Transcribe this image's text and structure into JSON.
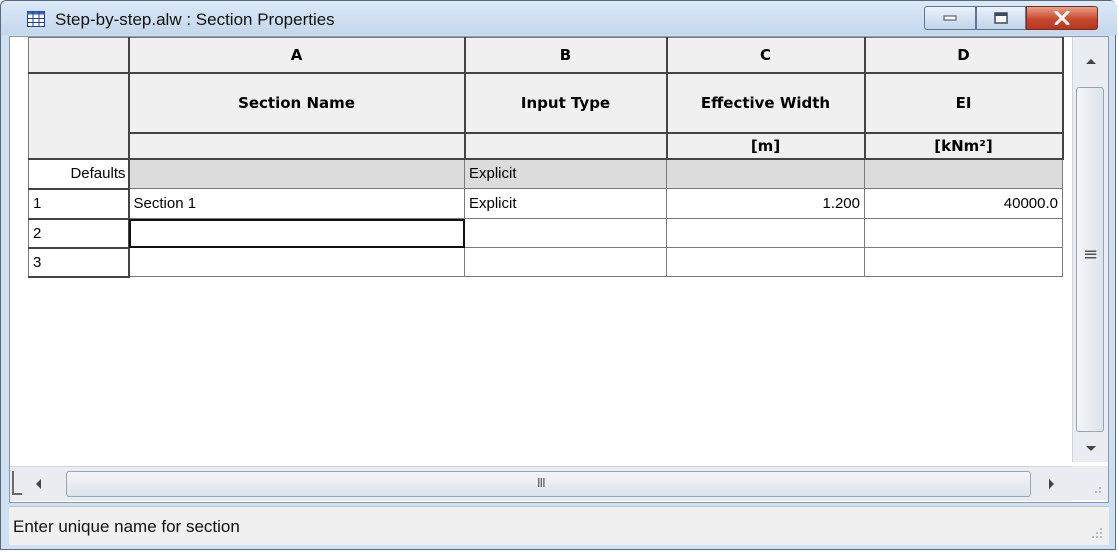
{
  "window": {
    "title": "Step-by-step.alw : Section Properties"
  },
  "grid": {
    "column_letters": [
      "A",
      "B",
      "C",
      "D"
    ],
    "column_titles": [
      "Section Name",
      "Input Type",
      "Effective Width",
      "EI"
    ],
    "column_units": [
      "",
      "",
      "[m]",
      "[kNm²]"
    ],
    "defaults_row": {
      "label": "Defaults",
      "cells": [
        "",
        "Explicit",
        "",
        ""
      ]
    },
    "rows": [
      {
        "label": "1",
        "cells": [
          "Section 1",
          "Explicit",
          "1.200",
          "40000.0"
        ]
      },
      {
        "label": "2",
        "cells": [
          "",
          "",
          "",
          ""
        ]
      },
      {
        "label": "3",
        "cells": [
          "",
          "",
          "",
          ""
        ]
      }
    ]
  },
  "scrollbar": {
    "h_thumb_glyph": "III",
    "v_thumb_glyph": "≡"
  },
  "statusbar": {
    "text": "Enter unique name for section"
  },
  "colors": {
    "title_bar": "#c4d7ec",
    "close_button": "#c84a2d",
    "defaults_row_fill": "#dcdcdc"
  }
}
